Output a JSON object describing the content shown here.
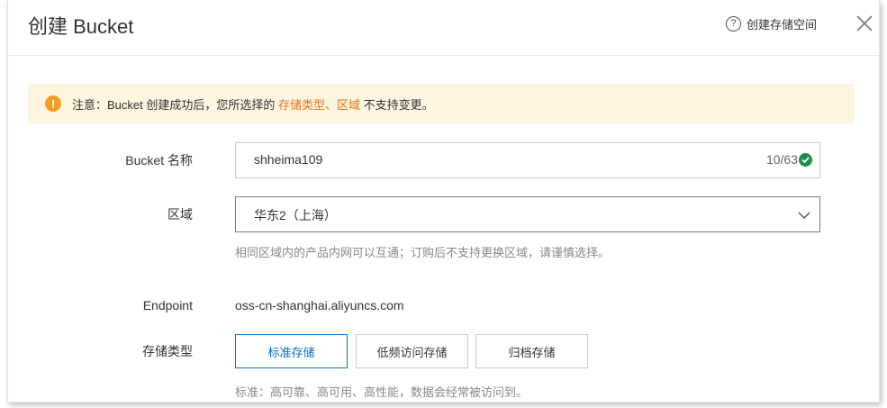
{
  "dialog": {
    "title": "创建 Bucket",
    "help_link": "创建存储空间",
    "notice": {
      "prefix": "注意：Bucket 创建成功后，您所选择的 ",
      "highlight1": "存储类型",
      "sep": "、",
      "highlight2": "区域",
      "suffix": " 不支持变更。"
    }
  },
  "form": {
    "bucket_name": {
      "label": "Bucket 名称",
      "value": "shheima109",
      "counter": "10/63"
    },
    "region": {
      "label": "区域",
      "value": "华东2（上海）",
      "hint": "相同区域内的产品内网可以互通；订购后不支持更换区域，请谨慎选择。"
    },
    "endpoint": {
      "label": "Endpoint",
      "value": "oss-cn-shanghai.aliyuncs.com"
    },
    "storage_class": {
      "label": "存储类型",
      "options": [
        "标准存储",
        "低频访问存储",
        "归档存储"
      ],
      "selected": "标准存储",
      "hint": "标准：高可靠、高可用、高性能，数据会经常被访问到。"
    }
  },
  "colors": {
    "accent": "#0070cc",
    "highlight": "#e4741a",
    "notice_bg": "#fdf5df",
    "valid": "#1d8f4a"
  }
}
